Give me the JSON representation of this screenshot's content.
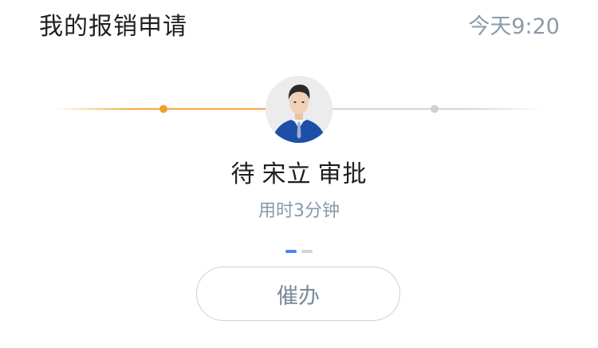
{
  "header": {
    "title": "我的报销申请",
    "time": "今天9:20"
  },
  "approval": {
    "status_prefix": "待",
    "approver_name": "宋立",
    "status_suffix": "审批",
    "duration": "用时3分钟",
    "progress_fraction": 0.5,
    "steps": [
      "done",
      "current",
      "pending"
    ]
  },
  "pager": {
    "count": 2,
    "active_index": 0
  },
  "actions": {
    "urge_label": "催办"
  },
  "colors": {
    "done": "#f0a030",
    "pending": "#d0d0d0",
    "pager_active": "#4a86f0",
    "muted_text": "#8a9aa8"
  },
  "icons": {
    "avatar": "person-in-blue-suit"
  }
}
